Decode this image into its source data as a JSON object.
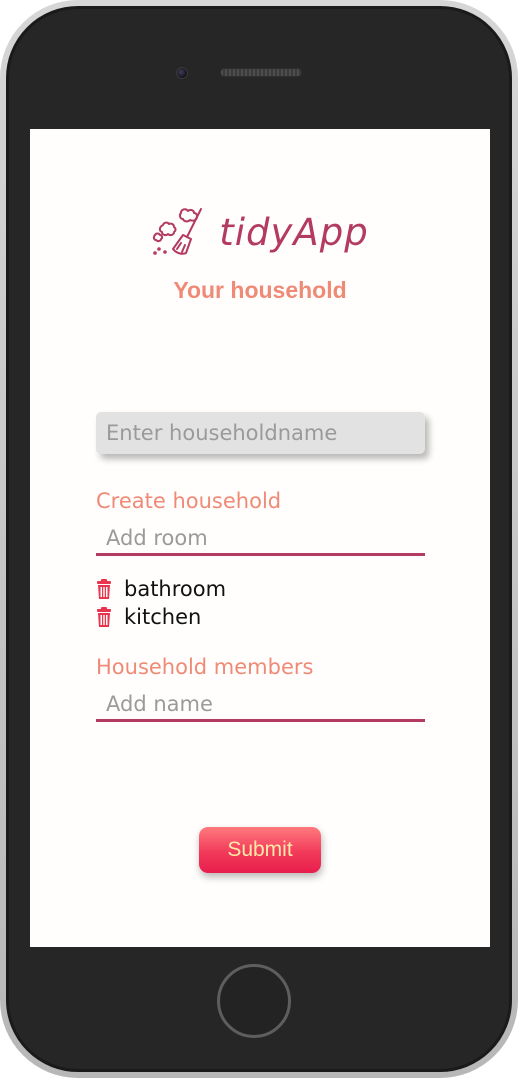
{
  "app": {
    "name": "tidyApp",
    "subtitle": "Your household",
    "logo_icon": "broom-icon"
  },
  "household_name_input": {
    "placeholder": "Enter householdname",
    "value": ""
  },
  "rooms_section": {
    "label": "Create household",
    "input_placeholder": "Add room",
    "rooms": [
      {
        "name": "bathroom",
        "icon": "trash-icon"
      },
      {
        "name": "kitchen",
        "icon": "trash-icon"
      }
    ]
  },
  "members_section": {
    "label": "Household members",
    "input_placeholder": "Add name"
  },
  "submit_label": "Submit",
  "colors": {
    "brand": "#b33a63",
    "label": "#ef8a76",
    "trash": "#e8344f",
    "submit_text": "#ffe9a8",
    "submit_bg": "#f23a5a"
  }
}
